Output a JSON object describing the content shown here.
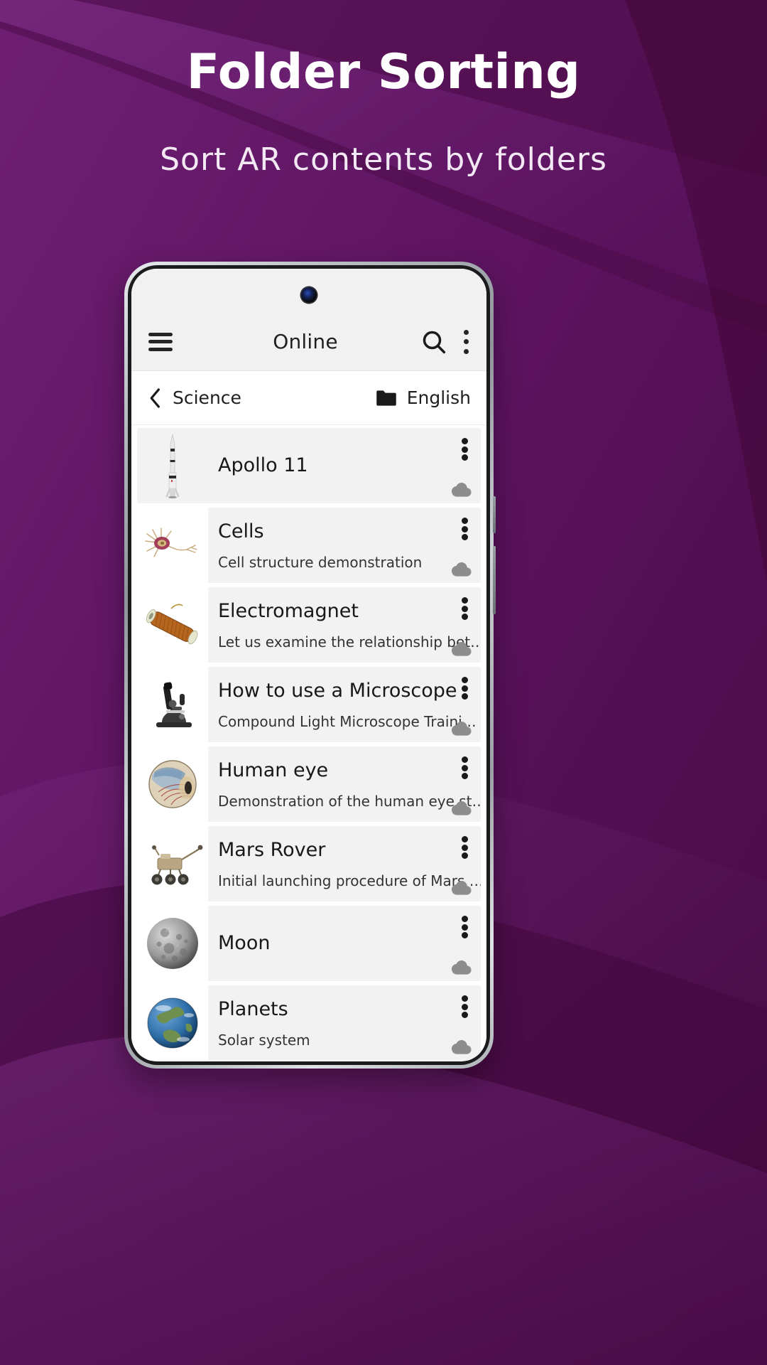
{
  "promo": {
    "title": "Folder Sorting",
    "subtitle": "Sort AR contents by folders",
    "colors": {
      "bg_dark": "#4e0d4e",
      "bg_mid": "#6d1b6d",
      "bg_light": "#7d2a86",
      "title_color": "#ffffff",
      "subtitle_color": "#f3e9f5"
    }
  },
  "app": {
    "appbar": {
      "title": "Online",
      "menu_icon": "hamburger-icon",
      "search_icon": "search-icon",
      "overflow_icon": "kebab-menu-icon"
    },
    "breadcrumb": {
      "back_icon": "chevron-left-icon",
      "parent_label": "Science",
      "folder_icon": "folder-icon",
      "folder_label": "English"
    },
    "list": [
      {
        "title": "Apollo 11",
        "description": "",
        "thumb": "rocket-thumbnail",
        "overflow_icon": "kebab-menu-icon",
        "status_icon": "cloud-icon"
      },
      {
        "title": "Cells",
        "description": "Cell structure demonstration",
        "thumb": "neuron-cell-thumbnail",
        "overflow_icon": "kebab-menu-icon",
        "status_icon": "cloud-icon"
      },
      {
        "title": "Electromagnet",
        "description": "Let us examine the relationship bet…",
        "thumb": "electromagnet-coil-thumbnail",
        "overflow_icon": "kebab-menu-icon",
        "status_icon": "cloud-icon"
      },
      {
        "title": "How to use a Microscope",
        "description": "Compound Light Microscope Traini…",
        "thumb": "microscope-thumbnail",
        "overflow_icon": "kebab-menu-icon",
        "status_icon": "cloud-icon"
      },
      {
        "title": "Human eye",
        "description": "Demonstration of the human eye st…",
        "thumb": "human-eye-thumbnail",
        "overflow_icon": "kebab-menu-icon",
        "status_icon": "cloud-icon"
      },
      {
        "title": "Mars Rover",
        "description": "Initial launching procedure of Mars …",
        "thumb": "mars-rover-thumbnail",
        "overflow_icon": "kebab-menu-icon",
        "status_icon": "cloud-icon"
      },
      {
        "title": "Moon",
        "description": "",
        "thumb": "moon-thumbnail",
        "overflow_icon": "kebab-menu-icon",
        "status_icon": "cloud-icon"
      },
      {
        "title": "Planets",
        "description": "Solar system",
        "thumb": "earth-planet-thumbnail",
        "overflow_icon": "kebab-menu-icon",
        "status_icon": "cloud-icon"
      }
    ]
  }
}
